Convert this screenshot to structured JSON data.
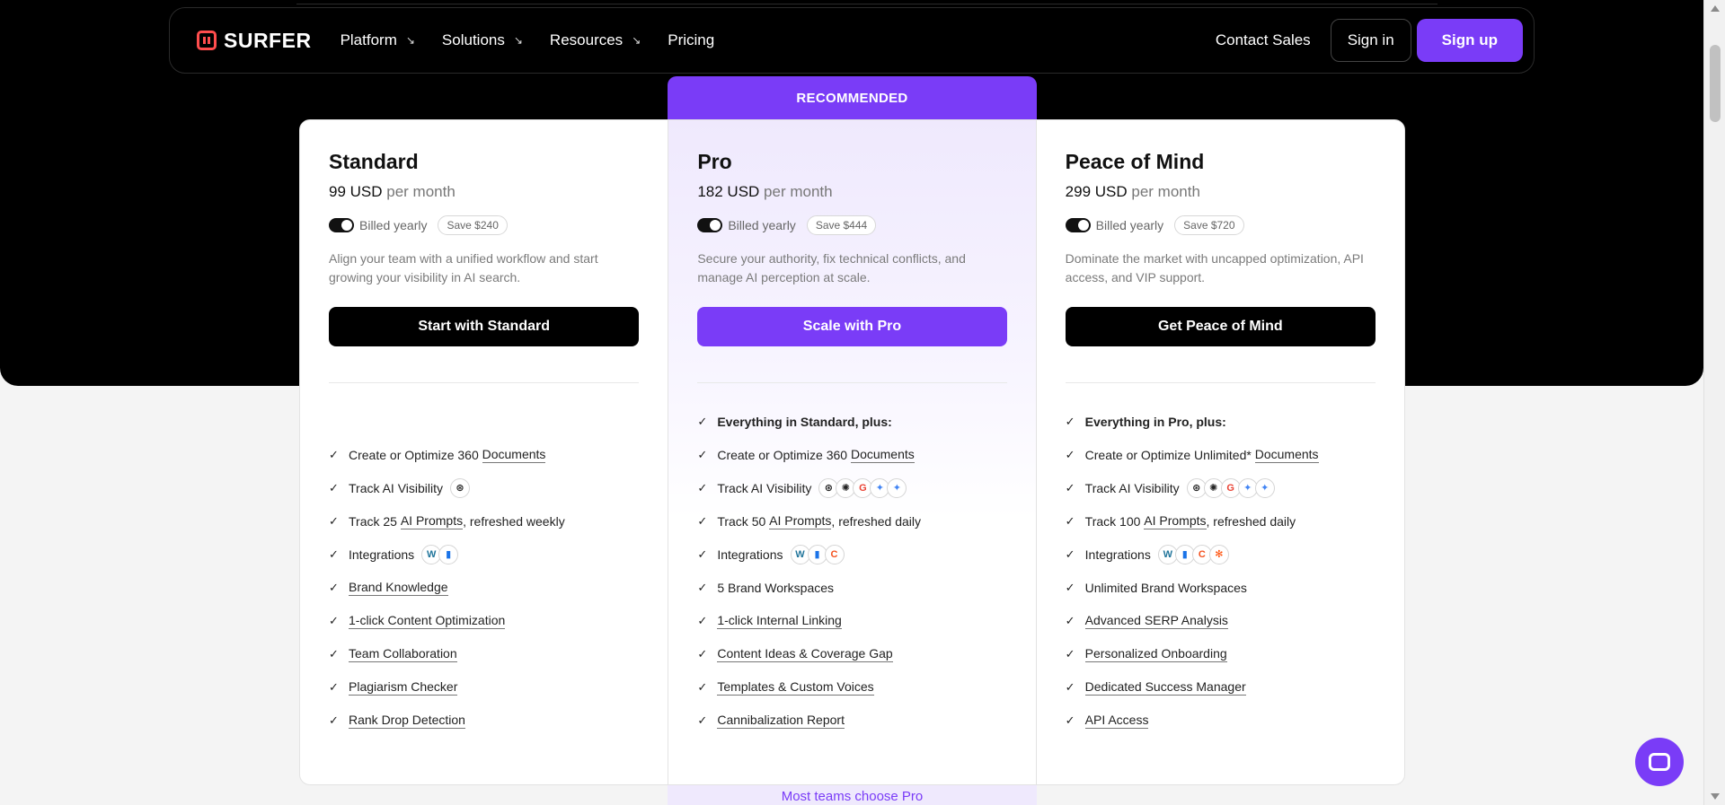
{
  "nav": {
    "brand": "SURFER",
    "items": [
      "Platform",
      "Solutions",
      "Resources",
      "Pricing"
    ],
    "arrow": "↘",
    "contact": "Contact Sales",
    "signin": "Sign in",
    "signup": "Sign up"
  },
  "recommended": "RECOMMENDED",
  "plans": [
    {
      "name": "Standard",
      "price": "99 USD",
      "unit": "per month",
      "billing": "Billed yearly",
      "save": "Save $240",
      "desc": "Align your team with a unified workflow and start growing your visibility in AI search.",
      "cta": "Start with Standard",
      "f": {
        "docs_pre": "Create or Optimize 360",
        "docs_link": "Documents",
        "ai_vis": "Track AI Visibility",
        "prompts_pre": "Track 25",
        "prompts_link": "AI Prompts",
        "prompts_post": ", refreshed weekly",
        "integrations": "Integrations",
        "f5": "Brand Knowledge",
        "f6": "1-click Content Optimization",
        "f7": "Team Collaboration",
        "f8": "Plagiarism Checker",
        "f9": "Rank Drop Detection"
      }
    },
    {
      "name": "Pro",
      "price": "182 USD",
      "unit": "per month",
      "billing": "Billed yearly",
      "save": "Save $444",
      "desc": "Secure your authority, fix technical conflicts, and manage AI perception at scale.",
      "cta": "Scale with Pro",
      "f": {
        "head": "Everything in Standard, plus:",
        "docs_pre": "Create or Optimize 360",
        "docs_link": "Documents",
        "ai_vis": "Track AI Visibility",
        "prompts_pre": "Track 50",
        "prompts_link": "AI Prompts",
        "prompts_post": ", refreshed daily",
        "integrations": "Integrations",
        "f5": "5 Brand Workspaces",
        "f6": "1-click Internal Linking",
        "f7": "Content Ideas & Coverage Gap",
        "f8": "Templates & Custom Voices",
        "f9": "Cannibalization Report"
      }
    },
    {
      "name": "Peace of Mind",
      "price": "299 USD",
      "unit": "per month",
      "billing": "Billed yearly",
      "save": "Save $720",
      "desc": "Dominate the market with uncapped optimization, API access, and VIP support.",
      "cta": "Get Peace of Mind",
      "f": {
        "head": "Everything in Pro, plus:",
        "docs_pre": "Create or Optimize Unlimited*",
        "docs_link": "Documents",
        "ai_vis": "Track AI Visibility",
        "prompts_pre": "Track 100",
        "prompts_link": "AI Prompts",
        "prompts_post": ", refreshed daily",
        "integrations": "Integrations",
        "f5": "Unlimited Brand Workspaces",
        "f6": "Advanced SERP Analysis",
        "f7": "Personalized Onboarding",
        "f8": "Dedicated Success Manager",
        "f9": "API Access"
      }
    }
  ],
  "check": "✓",
  "icons": {
    "chatgpt": "⊛",
    "gemini": "✦",
    "google": "G",
    "wordpress": "W",
    "docs": "▮",
    "copilot": "C",
    "claude": "✻",
    "perplexity": "✺"
  },
  "colors": {
    "accent": "#7a3cf7",
    "dark": "#000000"
  },
  "bottom_text": "Most teams choose Pro"
}
